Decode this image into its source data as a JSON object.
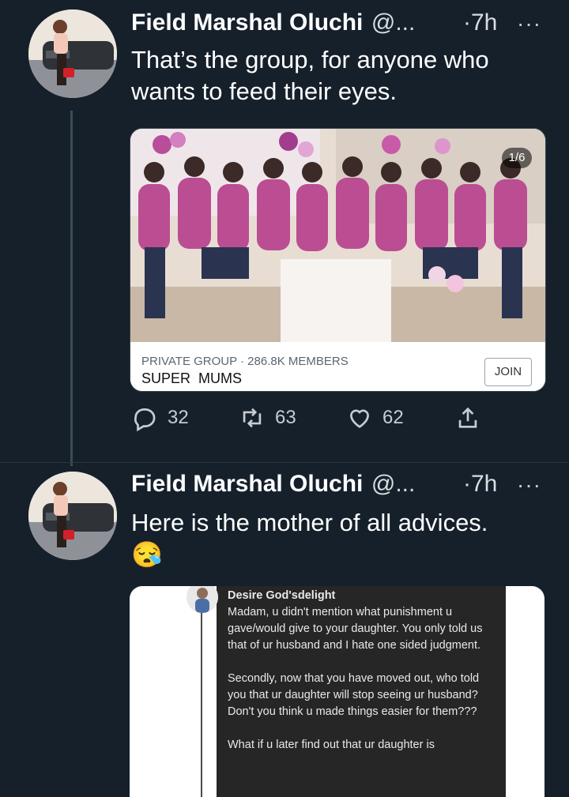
{
  "tweets": [
    {
      "name": "Field Marshal Oluchi",
      "handle": "@...",
      "time": "·7h",
      "more": "···",
      "text": "That’s the group, for anyone who wants to feed their eyes.",
      "card": {
        "image_counter": "1/6",
        "banner_text": "SUPER MUMS",
        "subtitle": "PRIVATE GROUP · 286.8K MEMBERS",
        "title": "SUPER  MUMS",
        "join_label": "JOIN"
      },
      "actions": {
        "replies": "32",
        "retweets": "63",
        "likes": "62"
      }
    },
    {
      "name": "Field Marshal Oluchi",
      "handle": "@...",
      "time": "·7h",
      "more": "···",
      "text": "Here is the mother of all advices.",
      "emoji": "😪",
      "comment": {
        "author": "Desire God'sdelight",
        "para1": "Madam, u didn't mention what punishment u gave/would give to your daughter. You only told us that of ur husband and I hate one sided judgment.",
        "para2": "Secondly, now that you have moved out, who told you that ur daughter will stop seeing ur husband? Don't you think u made things easier for them???",
        "para3": "What if u later find out that ur daughter is"
      }
    }
  ]
}
